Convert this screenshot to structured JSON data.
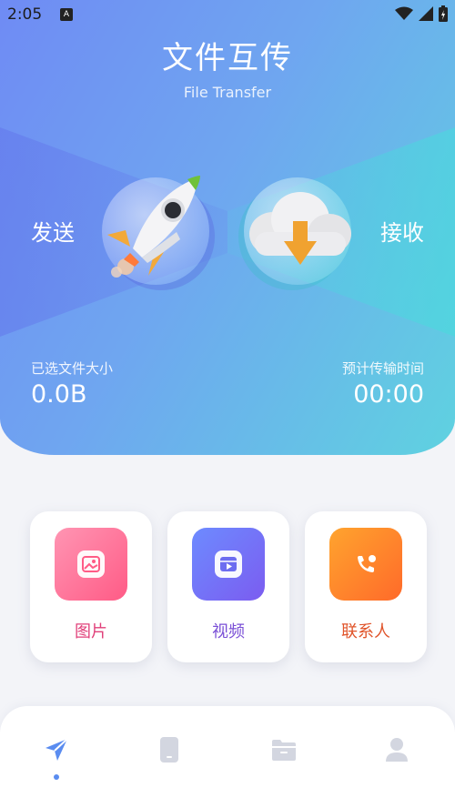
{
  "status_bar": {
    "time": "2:05",
    "badge": "A"
  },
  "header": {
    "title": "文件互传",
    "subtitle": "File Transfer"
  },
  "actions": {
    "send_label": "发送",
    "receive_label": "接收"
  },
  "stats": {
    "selected_size_label": "已选文件大小",
    "selected_size_value": "0.0B",
    "estimated_time_label": "预计传输时间",
    "estimated_time_value": "00:00"
  },
  "categories": [
    {
      "label": "图片",
      "icon": "image-icon",
      "color": "#e0407a"
    },
    {
      "label": "视频",
      "icon": "video-icon",
      "color": "#7a4fd6"
    },
    {
      "label": "联系人",
      "icon": "contact-icon",
      "color": "#e0542a"
    }
  ],
  "bottom_nav": {
    "items": [
      {
        "icon": "send-nav-icon",
        "active": true
      },
      {
        "icon": "phone-nav-icon",
        "active": false
      },
      {
        "icon": "folder-nav-icon",
        "active": false
      },
      {
        "icon": "profile-nav-icon",
        "active": false
      }
    ],
    "active_color": "#5a8cf0",
    "inactive_color": "#d3d6e0"
  }
}
